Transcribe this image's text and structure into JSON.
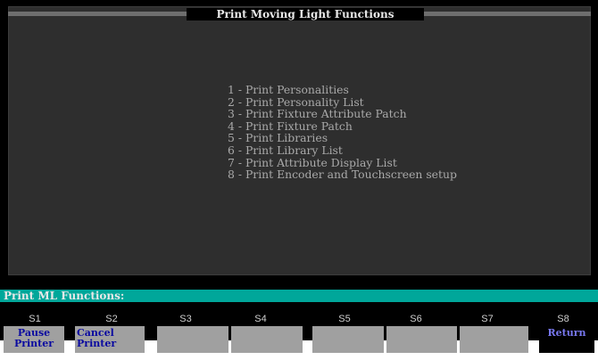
{
  "window": {
    "title": "Print Moving Light Functions"
  },
  "menu": {
    "items": [
      "1 - Print Personalities",
      "2 - Print Personality List",
      "3 - Print Fixture Attribute Patch",
      "4 - Print Fixture Patch",
      "5 - Print Libraries",
      "6 - Print Library List",
      "7 - Print Attribute Display List",
      "8 - Print Encoder and Touchscreen setup"
    ]
  },
  "prompt": {
    "text": "Print ML Functions:"
  },
  "softkeys": [
    {
      "key": "S1",
      "line1": "Pause",
      "line2": "Printer"
    },
    {
      "key": "S2",
      "line1": "Cancel",
      "line2": "Printer"
    },
    {
      "key": "S3",
      "line1": "",
      "line2": ""
    },
    {
      "key": "S4",
      "line1": "",
      "line2": ""
    },
    {
      "key": "S5",
      "line1": "",
      "line2": ""
    },
    {
      "key": "S6",
      "line1": "",
      "line2": ""
    },
    {
      "key": "S7",
      "line1": "",
      "line2": ""
    },
    {
      "key": "S8",
      "line1": "Return",
      "line2": ""
    }
  ],
  "colors": {
    "screen_bg": "#000000",
    "panel_bg": "#2e2e2e",
    "prompt_bar": "#00a79a",
    "softkey_face": "#a0a0a0",
    "softkey_label": "#0a0aa0",
    "menu_text": "#a9a9a9"
  }
}
